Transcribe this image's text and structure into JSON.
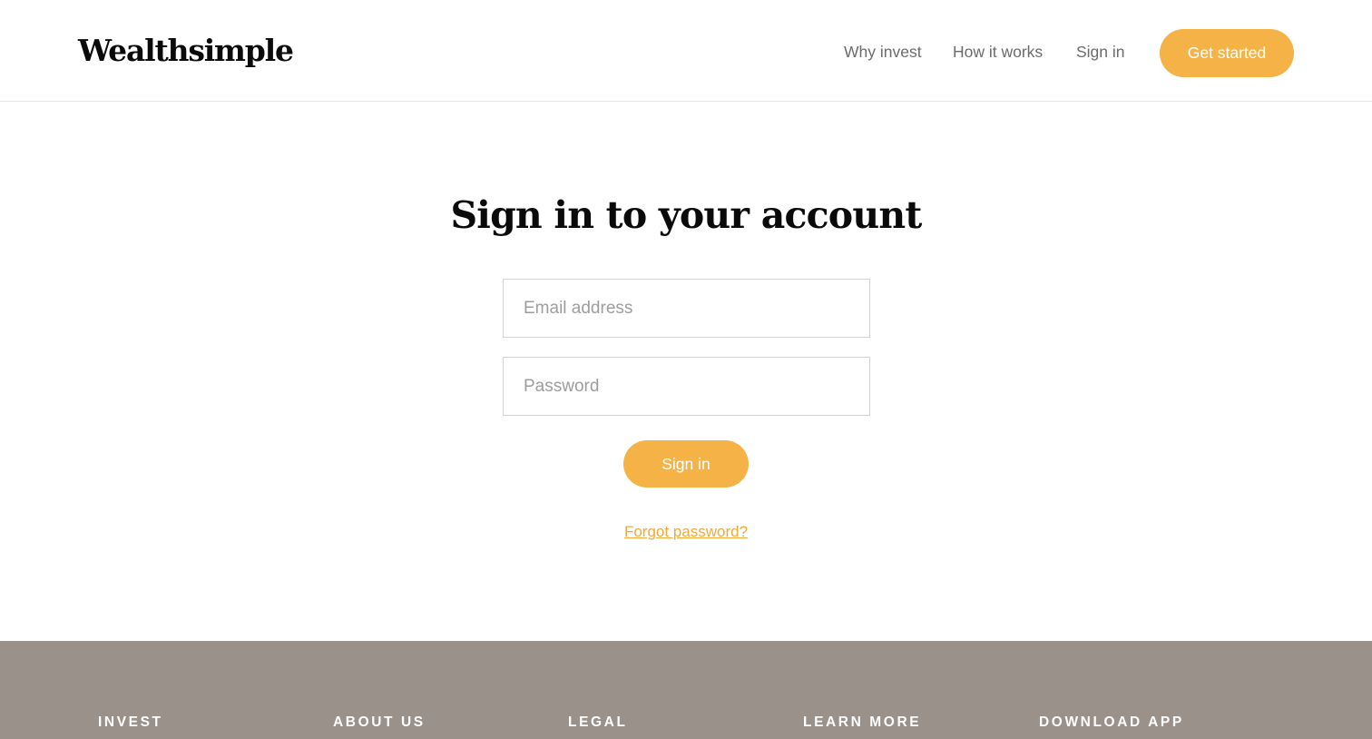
{
  "header": {
    "logo": "Wealthsimple",
    "nav": {
      "why_invest": "Why invest",
      "how_it_works": "How it works",
      "sign_in": "Sign in"
    },
    "cta_label": "Get started"
  },
  "main": {
    "title": "Sign in to your account",
    "email_placeholder": "Email address",
    "password_placeholder": "Password",
    "submit_label": "Sign in",
    "forgot_label": "Forgot password?"
  },
  "footer": {
    "headings": [
      "INVEST",
      "ABOUT US",
      "LEGAL",
      "LEARN MORE",
      "DOWNLOAD APP"
    ]
  },
  "colors": {
    "accent": "#f5b246",
    "footer_bg": "#9a918b"
  }
}
